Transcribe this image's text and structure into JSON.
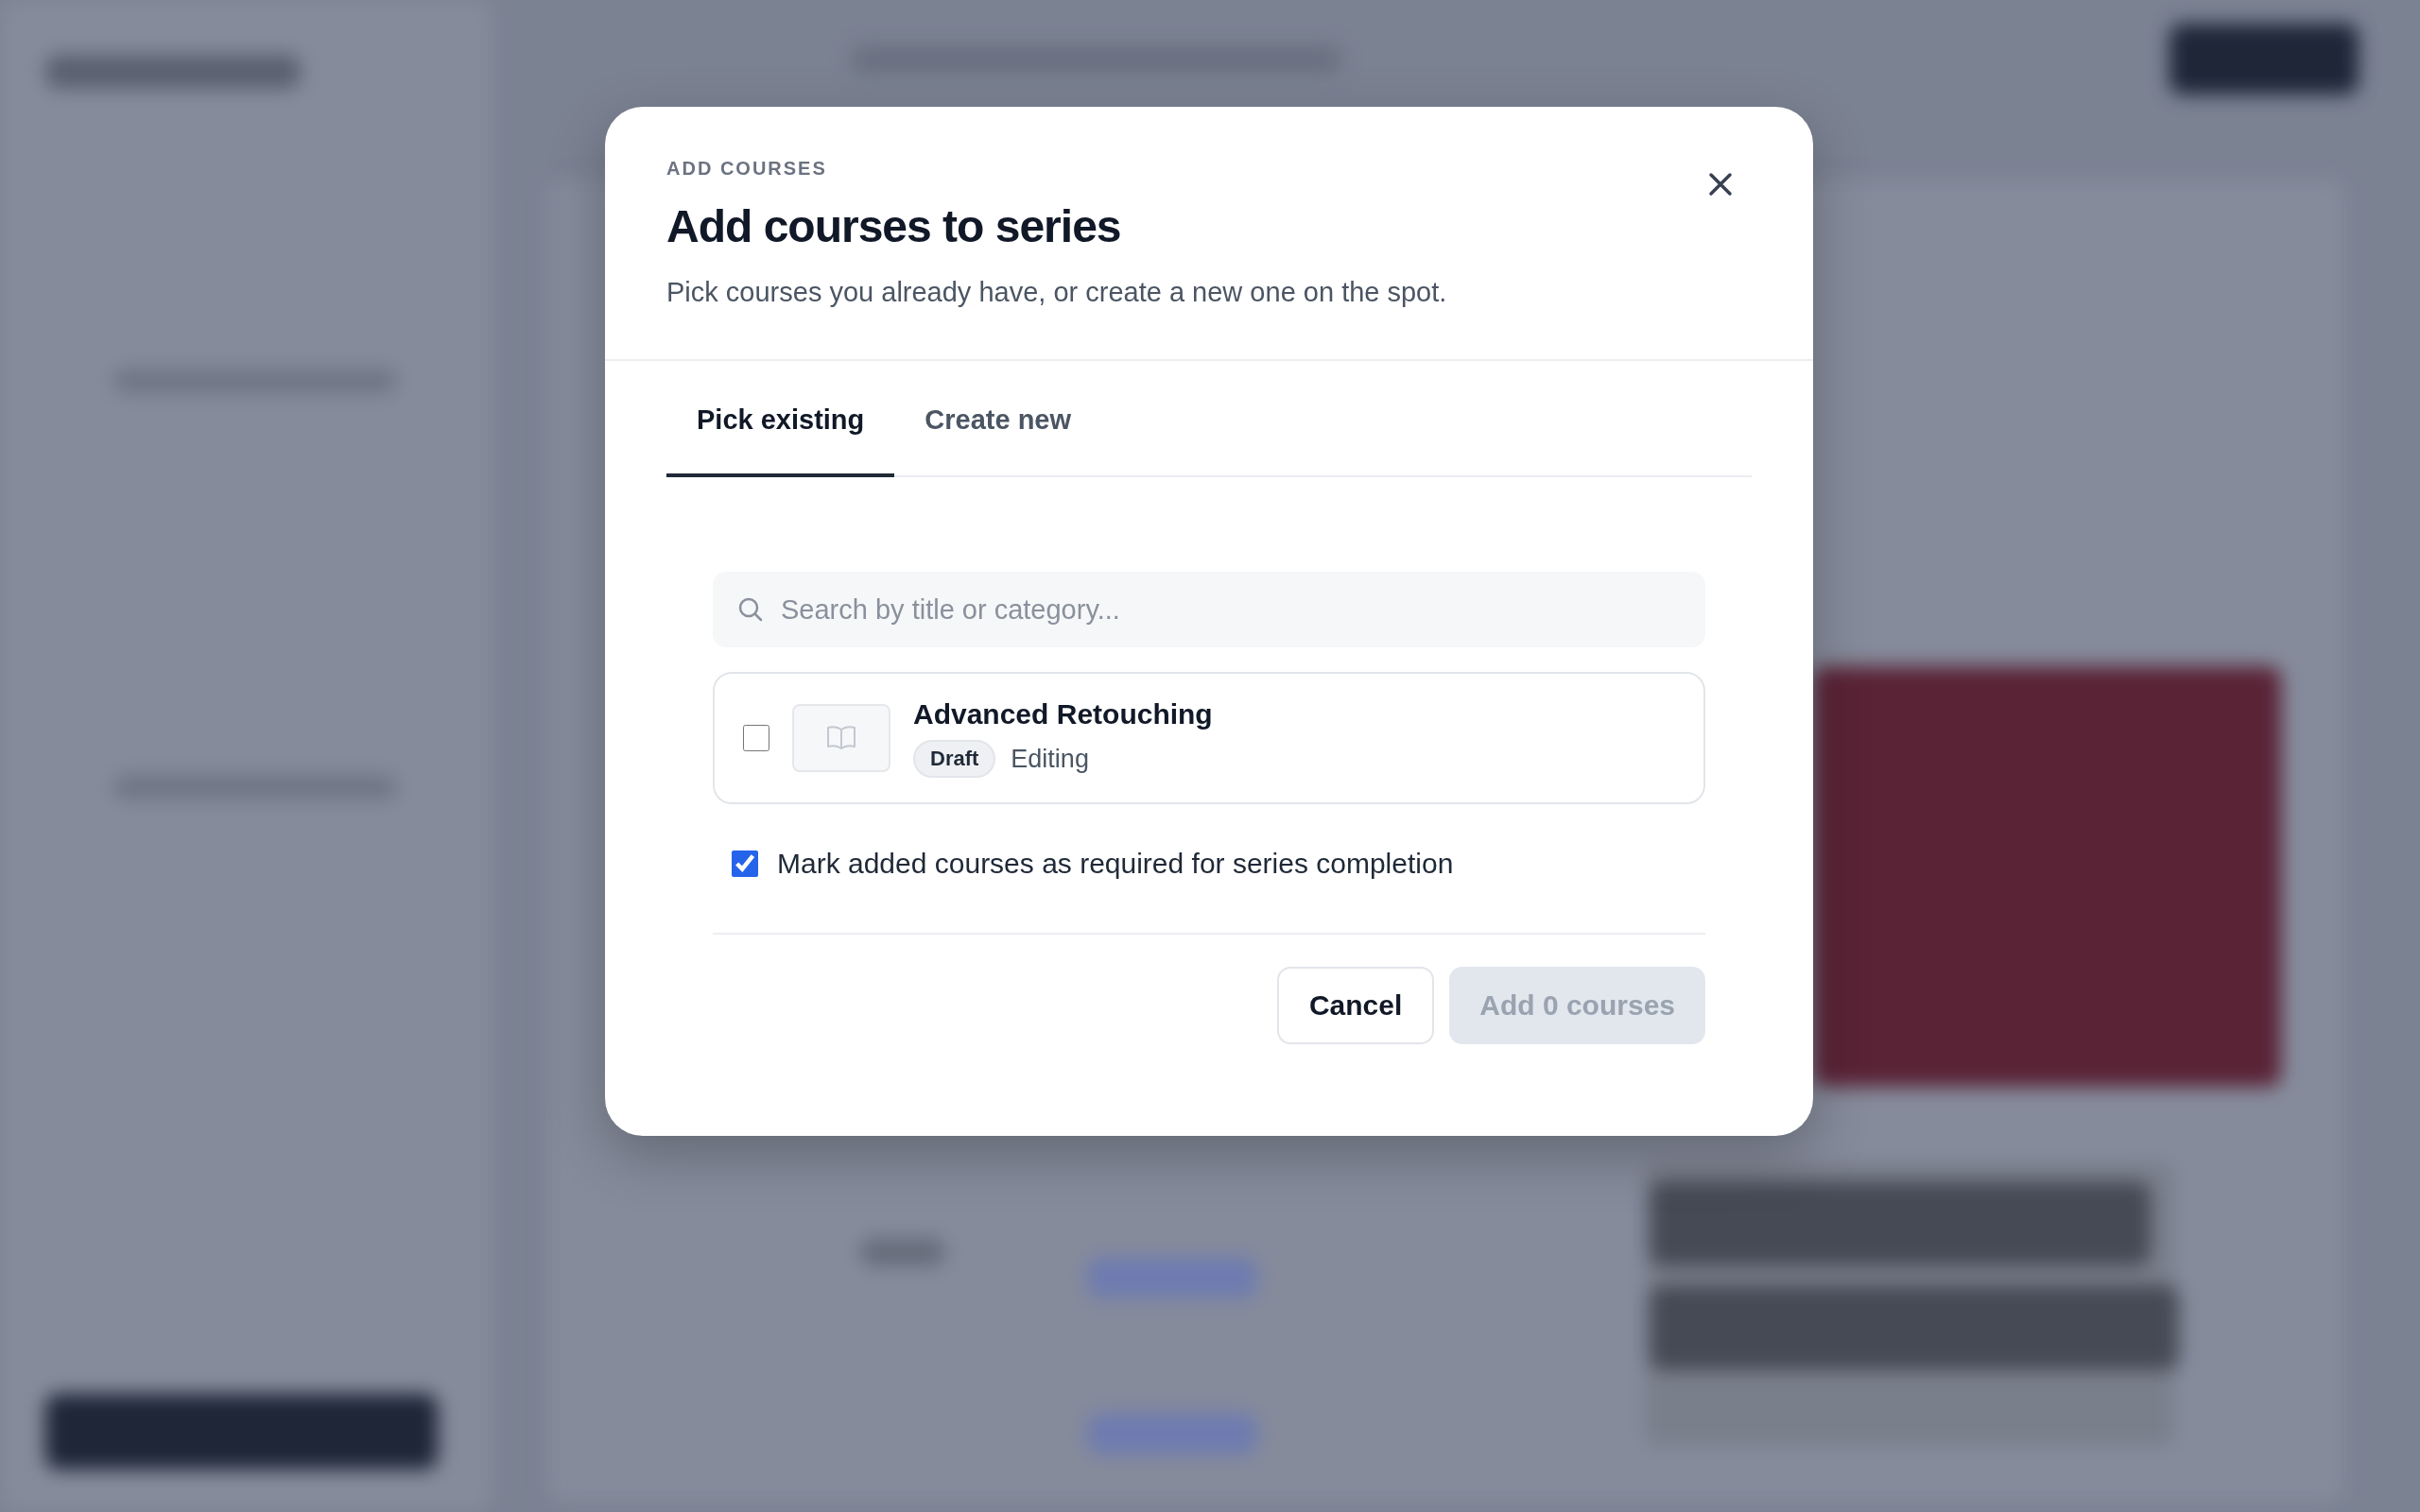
{
  "dialog": {
    "eyebrow": "ADD COURSES",
    "title": "Add courses to series",
    "subtitle": "Pick courses you already have, or create a new one on the spot.",
    "tabs": [
      {
        "label": "Pick existing",
        "selected": true
      },
      {
        "label": "Create new",
        "selected": false
      }
    ],
    "search": {
      "placeholder": "Search by title or category..."
    },
    "courses": [
      {
        "title": "Advanced Retouching",
        "status": "Draft",
        "note": "Editing",
        "checked": false
      }
    ],
    "required_option": {
      "label": "Mark added courses as required for series completion",
      "checked": true
    },
    "buttons": [
      {
        "label": "Cancel",
        "kind": "secondary",
        "disabled": false
      },
      {
        "label": "Add 0 courses",
        "kind": "primary",
        "disabled": true
      }
    ]
  }
}
